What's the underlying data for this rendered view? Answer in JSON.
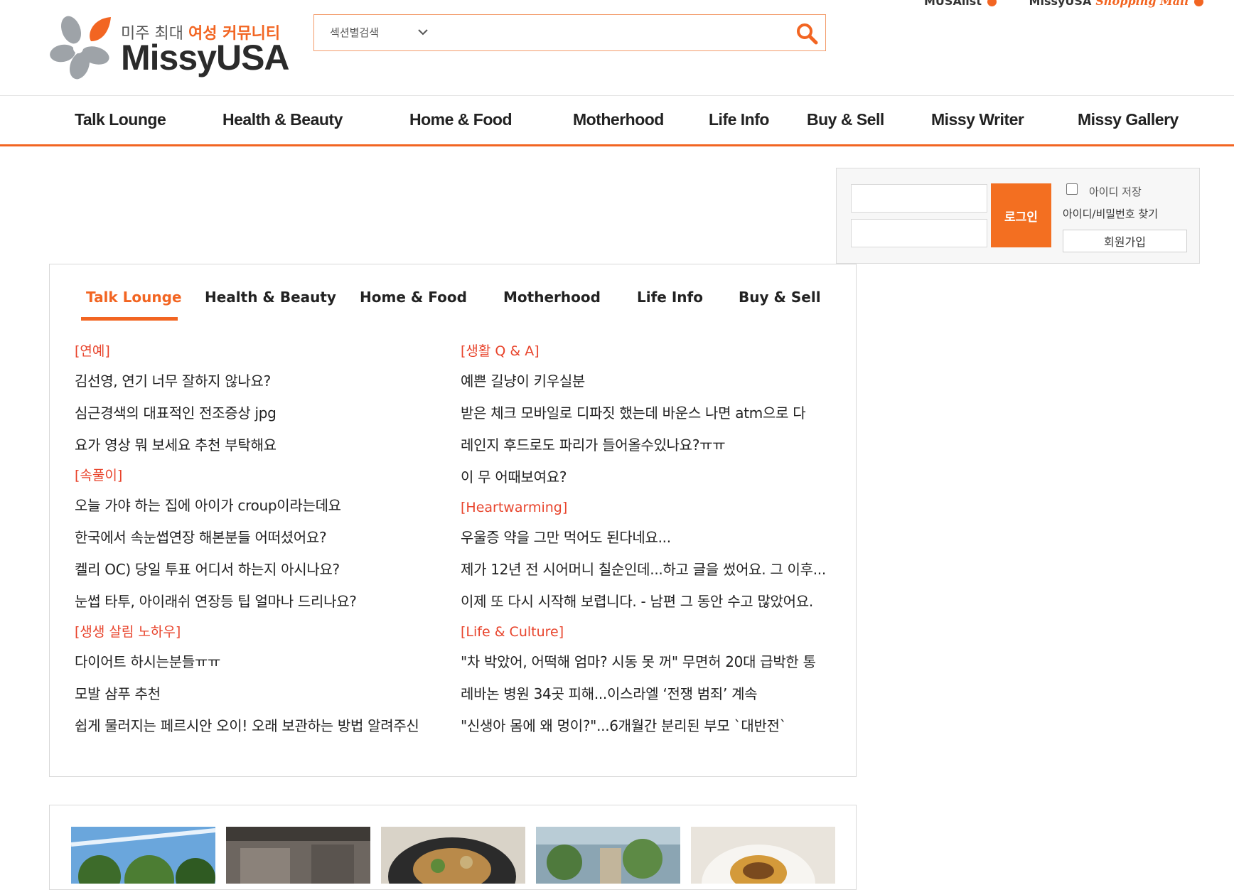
{
  "top_links": {
    "musa_list": "MUSAlist",
    "shopping_brand": "MissyUSA",
    "shopping_label": "Shopping Mall"
  },
  "logo": {
    "tagline_prefix": "미주 최대",
    "tagline_highlight": "여성 커뮤니티",
    "wordmark": "MissyUSA"
  },
  "search": {
    "section_select": "섹션별검색",
    "query": ""
  },
  "main_nav": [
    "Talk Lounge",
    "Health & Beauty",
    "Home & Food",
    "Motherhood",
    "Life Info",
    "Buy & Sell",
    "Missy Writer",
    "Missy Gallery"
  ],
  "login": {
    "button": "로그인",
    "remember_id": "아이디 저장",
    "find_account": "아이디/비밀번호 찾기",
    "join": "회원가입"
  },
  "board": {
    "tabs": [
      "Talk Lounge",
      "Health & Beauty",
      "Home & Food",
      "Motherhood",
      "Life Info",
      "Buy & Sell"
    ],
    "active_tab": "Talk Lounge",
    "left": [
      {
        "category": "[연예]",
        "posts": [
          "김선영, 연기 너무 잘하지 않나요?",
          "심근경색의 대표적인 전조증상 jpg",
          "요가 영상 뭐 보세요 추천 부탁해요"
        ]
      },
      {
        "category": "[속풀이]",
        "posts": [
          "오늘 가야 하는 집에 아이가 croup이라는데요",
          "한국에서 속눈썹연장 해본분들 어떠셨어요?",
          "켈리 OC) 당일 투표 어디서 하는지 아시나요?",
          "눈썹 타투, 아이래쉬 연장등 팁 얼마나 드리나요?"
        ]
      },
      {
        "category": "[생생 살림 노하우]",
        "posts": [
          "다이어트 하시는분들ㅠㅠ",
          "모발 샴푸 추천",
          "쉽게 물러지는 페르시안 오이! 오래 보관하는 방법 알려주신"
        ]
      }
    ],
    "right": [
      {
        "category": "[생활 Q & A]",
        "posts": [
          "예쁜 길냥이 키우실분",
          "받은 체크 모바일로 디파짓 했는데 바운스 나면 atm으로 다",
          "레인지 후드로도 파리가 들어올수있나요?ㅠㅠ",
          "이 무 어때보여요?"
        ]
      },
      {
        "category": "[Heartwarming]",
        "posts": [
          "우울증 약을 그만 먹어도 된다네요...",
          "제가 12년 전 시어머니 칠순인데...하고 글을 썼어요. 그 이후...",
          "이제 또 다시 시작해 보렵니다. - 남편 그 동안 수고 많았어요."
        ]
      },
      {
        "category": "[Life & Culture]",
        "posts": [
          "\"차 박았어, 어떡해 엄마? 시동 못 꺼\" 무면허 20대 급박한 통",
          "레바논 병원 34곳 피해...이스라엘 ‘전쟁 범죄’ 계속",
          "\"신생아 몸에 왜 멍이?\"...6개월간 분리된 부모 `대반전`"
        ]
      }
    ]
  },
  "gallery": {
    "thumbnails": [
      "tree-sky-photo",
      "kitchen-photo",
      "salad-dish-photo",
      "houseplant-photo",
      "plated-food-photo"
    ]
  },
  "colors": {
    "accent": "#f26522",
    "category_red": "#e8442c",
    "login_orange": "#f36f21"
  }
}
